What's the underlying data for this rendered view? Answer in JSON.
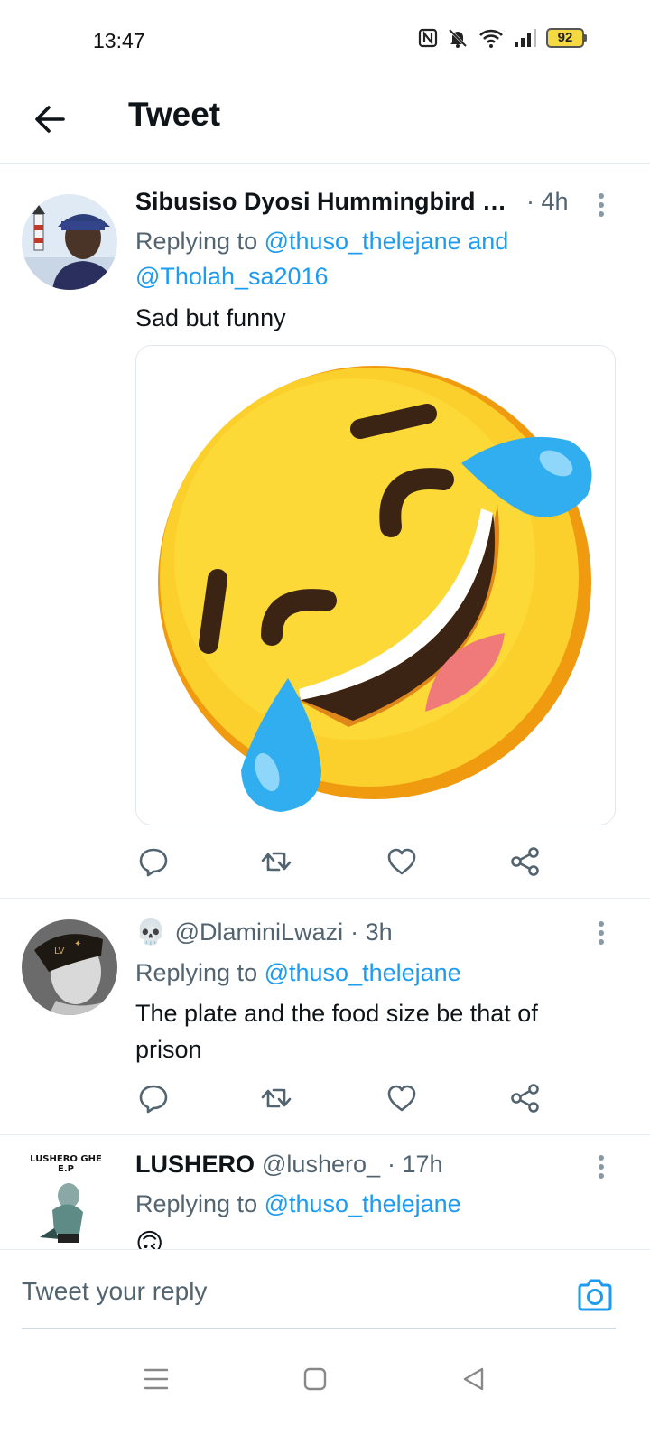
{
  "status_bar": {
    "time": "13:47",
    "battery": "92",
    "icons": [
      "nfc-icon",
      "bell-off-icon",
      "wifi-icon",
      "signal-icon",
      "battery-icon"
    ]
  },
  "header": {
    "title": "Tweet",
    "back_icon": "arrow-left-icon"
  },
  "tweets": [
    {
      "author_name": "Sibusiso Dyosi Hummingbird …",
      "handle": "",
      "time": "· 4h",
      "replying_prefix": "Replying to",
      "mention1": "@thuso_thelejane",
      "conjunction": "and",
      "mention2": "@Tholah_sa2016",
      "text": "Sad but funny",
      "media": "rolling-on-floor-laughing-emoji"
    },
    {
      "author_emoji": "💀",
      "handle": "@DlaminiLwazi",
      "time": "· 3h",
      "replying_prefix": "Replying to",
      "mention1": "@thuso_thelejane",
      "text": "The plate and the food size be that of prison"
    },
    {
      "author_name": "LUSHERO",
      "handle": "@lushero_",
      "time": "· 17h",
      "replying_prefix": "Replying to",
      "mention1": "@thuso_thelejane",
      "avatar_text_top": "LUSHERO GHE",
      "avatar_text_bottom": "E.P",
      "text_emoji": "🙃"
    }
  ],
  "composer": {
    "placeholder": "Tweet your reply",
    "camera_icon": "camera-icon"
  },
  "nav_bar": {
    "icons": [
      "menu-icon",
      "home-square-icon",
      "back-triangle-icon"
    ]
  },
  "colors": {
    "accent": "#1d9bf0",
    "text_secondary": "#536471",
    "text_primary": "#0f1419"
  }
}
